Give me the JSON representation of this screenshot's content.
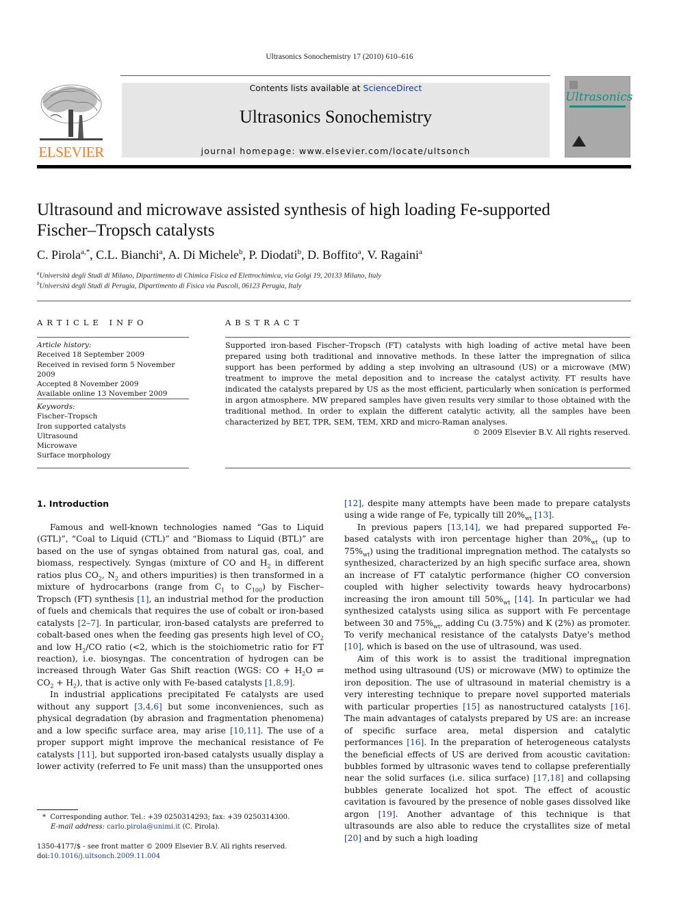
{
  "header": {
    "journal_ref": "Ultrasonics Sonochemistry 17 (2010) 610–616",
    "contents_prefix": "Contents lists available at ",
    "contents_link": "ScienceDirect",
    "journal_title": "Ultrasonics Sonochemistry",
    "homepage": "journal homepage: www.elsevier.com/locate/ultsonch",
    "publisher_logo_text": "ELSEVIER",
    "cover_title": "Ultrasonics",
    "logo_icon": "elsevier-tree-icon",
    "colors": {
      "elsevier_orange": "#f47b20",
      "link_blue": "#1f3c88",
      "cover_teal": "#1c8a76",
      "banner_gray": "#e6e6e6"
    }
  },
  "article": {
    "title_line1": "Ultrasound and microwave assisted synthesis of high loading Fe-supported",
    "title_line2": "Fischer–Tropsch catalysts",
    "authors": [
      {
        "name": "C. Pirola",
        "sup": "a,*",
        "sep": ", "
      },
      {
        "name": "C.L. Bianchi",
        "sup": "a",
        "sep": ", "
      },
      {
        "name": "A. Di Michele",
        "sup": "b",
        "sep": ", "
      },
      {
        "name": "P. Diodati",
        "sup": "b",
        "sep": ", "
      },
      {
        "name": "D. Boffito",
        "sup": "a",
        "sep": ", "
      },
      {
        "name": "V. Ragaini",
        "sup": "a",
        "sep": ""
      }
    ],
    "affiliations": [
      {
        "key": "a",
        "text": "Università degli Studi di Milano, Dipartimento di Chimica Fisica ed Elettrochimica, via Golgi 19, 20133 Milano, Italy"
      },
      {
        "key": "b",
        "text": "Università degli Studi di Perugia, Dipartimento di Fisica via Pascoli, 06123 Perugia, Italy"
      }
    ]
  },
  "article_info": {
    "heading": "ARTICLE INFO",
    "history_label": "Article history:",
    "history": [
      "Received 18 September 2009",
      "Received in revised form 5 November 2009",
      "Accepted 8 November 2009",
      "Available online 13 November 2009"
    ],
    "keywords_label": "Keywords:",
    "keywords": [
      "Fischer–Tropsch",
      "Iron supported catalysts",
      "Ultrasound",
      "Microwave",
      "Surface morphology"
    ]
  },
  "abstract": {
    "heading": "ABSTRACT",
    "text": "Supported iron-based Fischer–Tropsch (FT) catalysts with high loading of active metal have been prepared using both traditional and innovative methods. In these latter the impregnation of silica support has been performed by adding a step involving an ultrasound (US) or a microwave (MW) treatment to improve the metal deposition and to increase the catalyst activity. FT results have indicated the catalysts prepared by US as the most efficient, particularly when sonication is performed in argon atmosphere. MW prepared samples have given results very similar to those obtained with the traditional method. In order to explain the different catalytic activity, all the samples have been characterized by BET, TPR, SEM, TEM, XRD and micro-Raman analyses.",
    "copyright": "© 2009 Elsevier B.V. All rights reserved."
  },
  "intro": {
    "heading": "1. Introduction"
  },
  "footnotes": {
    "corresponding": "Corresponding author. Tel.: +39 0250314293; fax: +39 0250314300.",
    "email_label": "E-mail address: ",
    "email": "carlo.pirola@unimi.it",
    "email_suffix": " (C. Pirola).",
    "front_matter": "1350-4177/$ - see front matter © 2009 Elsevier B.V. All rights reserved.",
    "doi_prefix": "doi:",
    "doi": "10.1016/j.ultsonch.2009.11.004"
  }
}
